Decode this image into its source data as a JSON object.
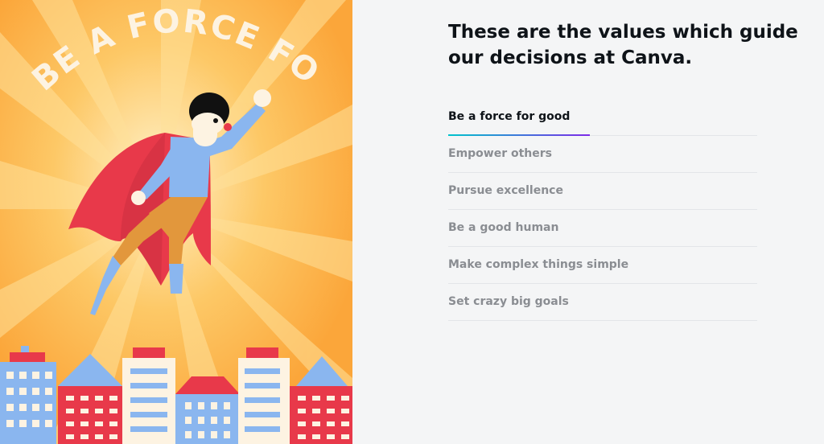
{
  "poster": {
    "headline": "BE A FORCE FOR GOOD",
    "colors": {
      "background": "#fbb13f",
      "rays": "#ffd98a",
      "cape": "#e8394a",
      "shirt": "#8ab6ef",
      "building_red": "#e8394a",
      "building_blue": "#8ab6ef",
      "building_cream": "#fdf3e2"
    }
  },
  "main": {
    "heading": "These are the values which guide our decisions at Canva.",
    "values": [
      {
        "label": "Be a force for good",
        "active": true
      },
      {
        "label": "Empower others",
        "active": false
      },
      {
        "label": "Pursue excellence",
        "active": false
      },
      {
        "label": "Be a good human",
        "active": false
      },
      {
        "label": "Make complex things simple",
        "active": false
      },
      {
        "label": "Set crazy big goals",
        "active": false
      }
    ],
    "accent": {
      "from": "#00c4cc",
      "to": "#7d2ae8"
    }
  }
}
